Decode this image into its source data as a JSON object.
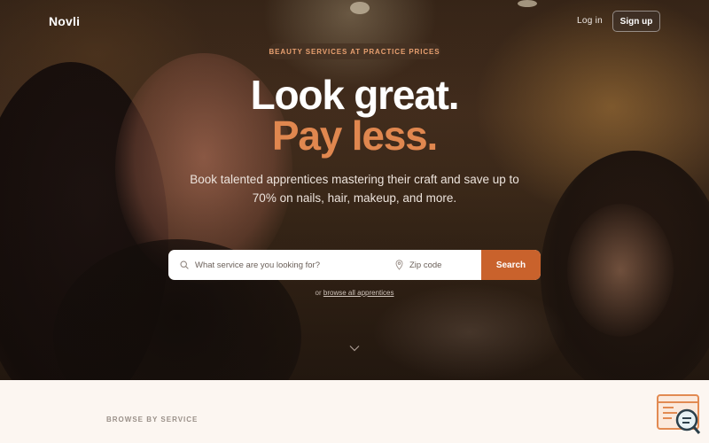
{
  "nav": {
    "logo": "Novli",
    "login_label": "Log in",
    "signup_label": "Sign up"
  },
  "hero": {
    "badge": "BEAUTY SERVICES AT PRACTICE PRICES",
    "headline_line1": "Look great.",
    "headline_line2": "Pay less.",
    "subtitle": "Book talented apprentices mastering their craft and save up to 70% on nails, hair, makeup, and more.",
    "search": {
      "service_placeholder": "What service are you looking for?",
      "zip_placeholder": "Zip code",
      "button_label": "Search",
      "search_icon": "search-icon",
      "location_icon": "map-pin-icon"
    },
    "alt_prefix": "or",
    "alt_link": "browse all apprentices",
    "scroll_icon": "chevron-down-icon"
  },
  "section": {
    "heading": "BROWSE BY SERVICE",
    "widget_icon": "chat-search-icon"
  },
  "colors": {
    "accent": "#e0874f",
    "button": "#c9622c",
    "section_bg": "#fcf6f1"
  }
}
